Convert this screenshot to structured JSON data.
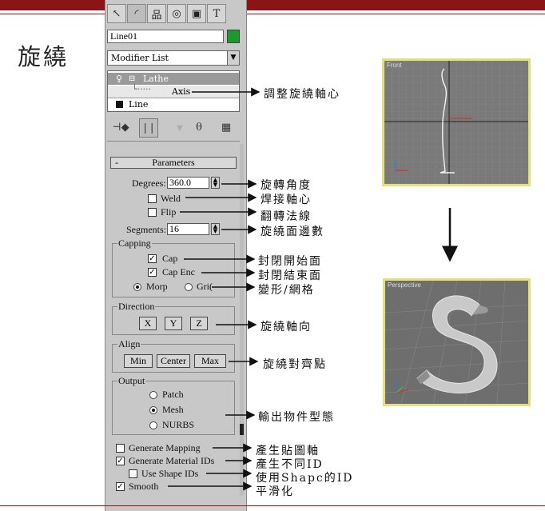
{
  "slide": {
    "title": "旋繞"
  },
  "panel": {
    "tabs": [
      "create-icon",
      "modify-icon",
      "hierarchy-icon",
      "motion-icon",
      "display-icon",
      "utilities-icon"
    ],
    "object_name": "Line01",
    "object_color": "#1a9a2a",
    "modifier_list": "Modifier List",
    "stack": [
      {
        "label": "Lathe",
        "selected": true
      },
      {
        "label": "Axis",
        "sub": true
      },
      {
        "label": "Line"
      }
    ],
    "rollout_title": "Parameters",
    "degrees_label": "Degrees:",
    "degrees_value": "360.0",
    "weld_label": "Weld",
    "flip_label": "Flip",
    "segments_label": "Segments:",
    "segments_value": "16",
    "capping": {
      "title": "Capping",
      "cap_start": "Cap",
      "cap_end": "Cap Enc",
      "morph": "Morp",
      "grid": "Gri("
    },
    "direction": {
      "title": "Direction",
      "buttons": [
        "X",
        "Y",
        "Z"
      ]
    },
    "align": {
      "title": "Align",
      "buttons": [
        "Min",
        "Center",
        "Max"
      ]
    },
    "output": {
      "title": "Output",
      "options": [
        "Patch",
        "Mesh",
        "NURBS"
      ],
      "selected": "Mesh"
    },
    "generate_mapping": "Generate Mapping",
    "generate_material_ids": "Generate Material IDs",
    "use_shape_ids": "Use Shape IDs",
    "smooth": "Smooth"
  },
  "annotations": {
    "axis": "調整旋繞軸心",
    "degrees": "旋轉角度",
    "weld": "焊接軸心",
    "flip": "翻轉法線",
    "segments": "旋繞面邊數",
    "cap_start": "封閉開始面",
    "cap_end": "封閉結束面",
    "morph_grid": "變形/網格",
    "direction": "旋繞軸向",
    "align": "旋繞對齊點",
    "output": "輸出物件型態",
    "generate_mapping": "產生貼圖軸",
    "generate_material_ids": "產生不同ID",
    "use_shape_ids": "使用Shapc的ID",
    "smooth": "平滑化"
  },
  "viewports": {
    "front_label": "Front",
    "perspective_label": "Perspective"
  },
  "colors": {
    "header_bar": "#8b1416",
    "viewport_border": "#e6e07a",
    "object_swatch": "#1a9a2a"
  }
}
